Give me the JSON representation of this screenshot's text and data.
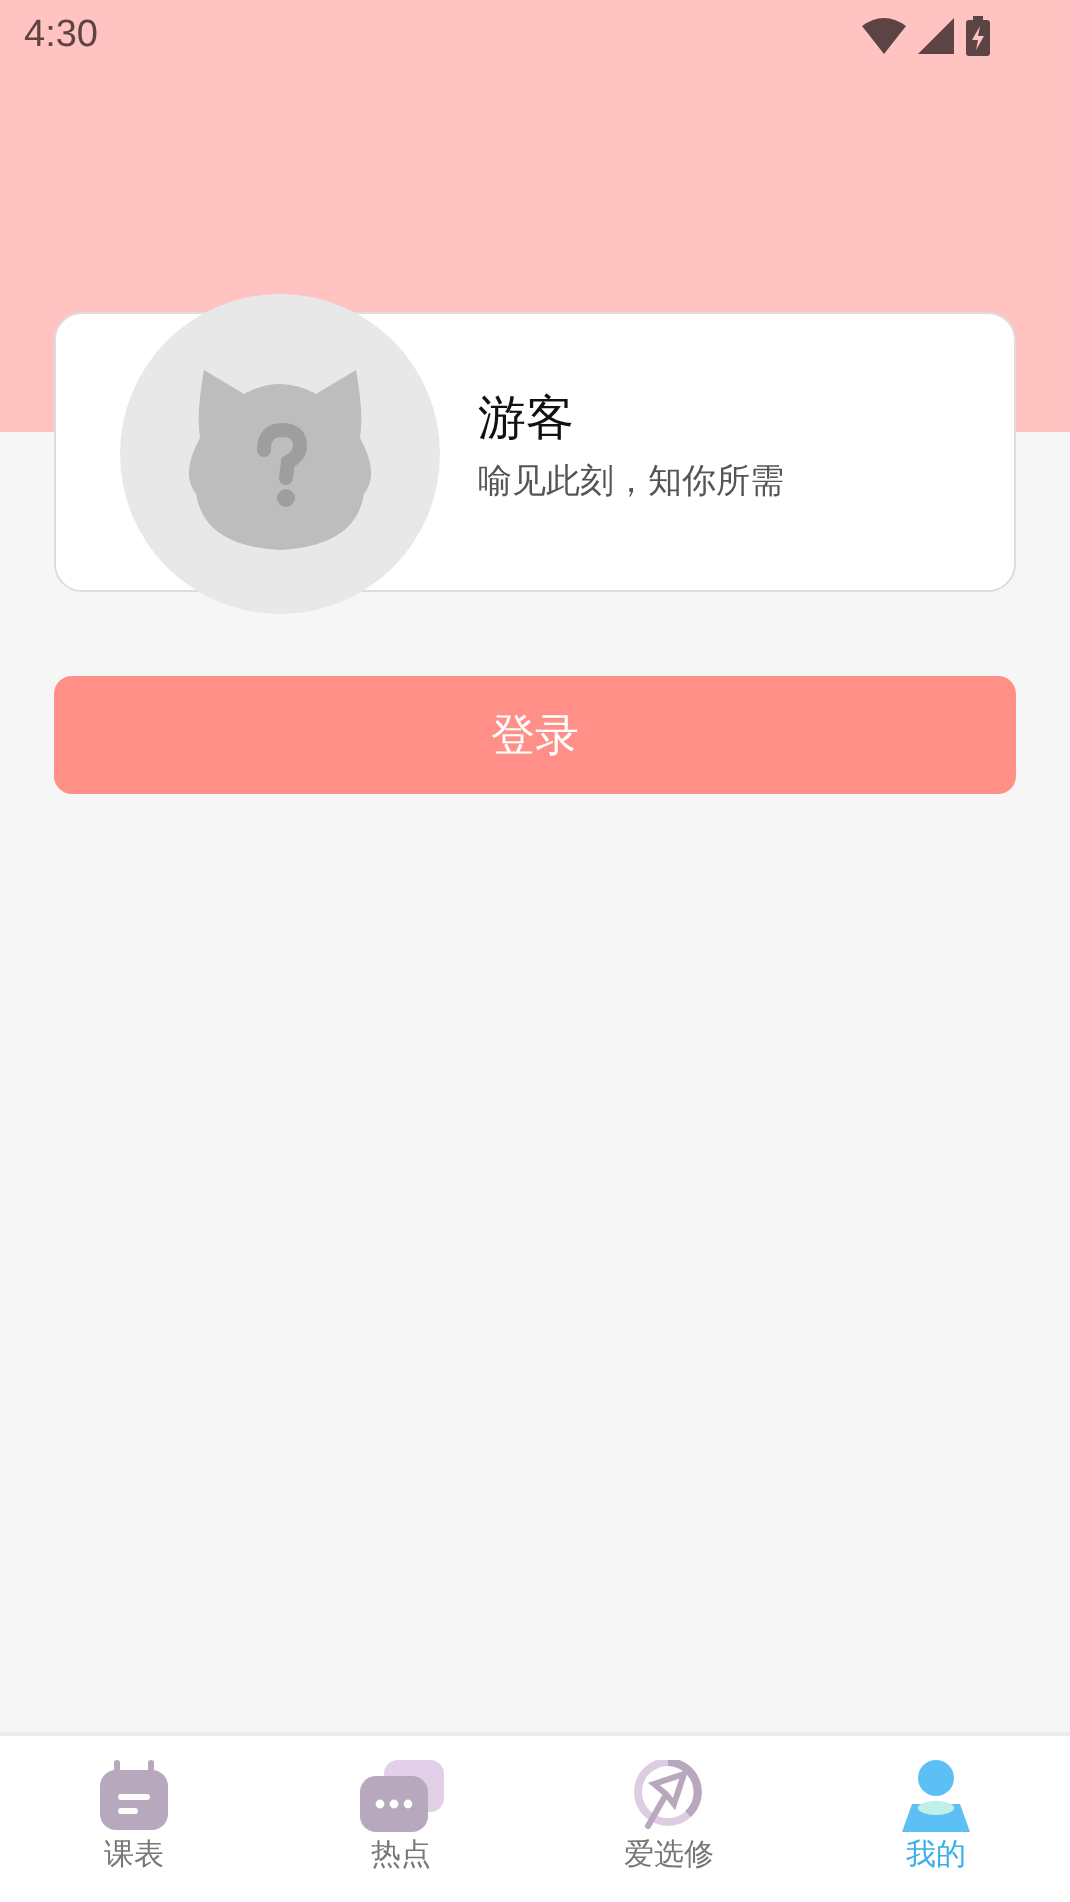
{
  "status_bar": {
    "time": "4:30"
  },
  "profile": {
    "name": "游客",
    "subtitle": "喻见此刻，知你所需"
  },
  "login_button": {
    "label": "登录"
  },
  "tabs": [
    {
      "label": "课表",
      "selected": false
    },
    {
      "label": "热点",
      "selected": false
    },
    {
      "label": "爱选修",
      "selected": false
    },
    {
      "label": "我的",
      "selected": true
    }
  ]
}
